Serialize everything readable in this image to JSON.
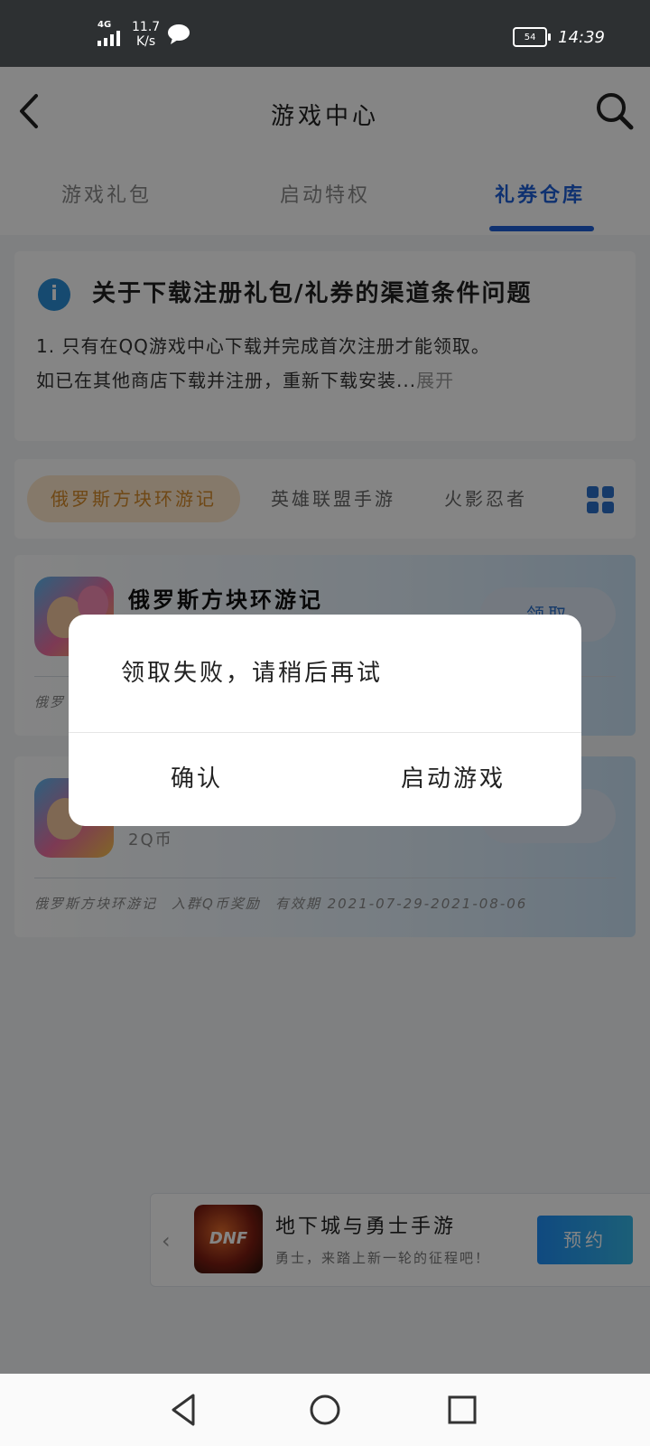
{
  "status_bar": {
    "network": "4G",
    "speed_value": "11.7",
    "speed_unit": "K/s",
    "battery": "54",
    "time": "14:39"
  },
  "nav": {
    "title": "游戏中心"
  },
  "tabs": [
    "游戏礼包",
    "启动特权",
    "礼券仓库"
  ],
  "notice": {
    "title": "关于下载注册礼包/礼券的渠道条件问题",
    "line1": "1. 只有在QQ游戏中心下载并完成首次注册才能领取。",
    "line2": "如已在其他商店下载并注册，重新下载安装...",
    "expand": "展开"
  },
  "categories": [
    "俄罗斯方块环游记",
    "英雄联盟手游",
    "火影忍者"
  ],
  "cards": [
    {
      "title": "俄罗斯方块环游记",
      "claim": "领取",
      "foot_prefix": "俄罗"
    },
    {
      "title": "",
      "sub": "2Q币",
      "foot_game": "俄罗斯方块环游记",
      "foot_name": "入群Q币奖励",
      "foot_validity": "有效期 2021-07-29-2021-08-06"
    }
  ],
  "banner": {
    "title": "地下城与勇士手游",
    "sub": "勇士，来踏上新一轮的征程吧！",
    "button": "预约",
    "icon_text": "DNF"
  },
  "dialog": {
    "message": "领取失败，请稍后再试",
    "confirm": "确认",
    "launch": "启动游戏"
  },
  "colors": {
    "accent": "#1d5fd6",
    "status_bg": "#2d3032",
    "orange_chip": "#d58a2a"
  }
}
